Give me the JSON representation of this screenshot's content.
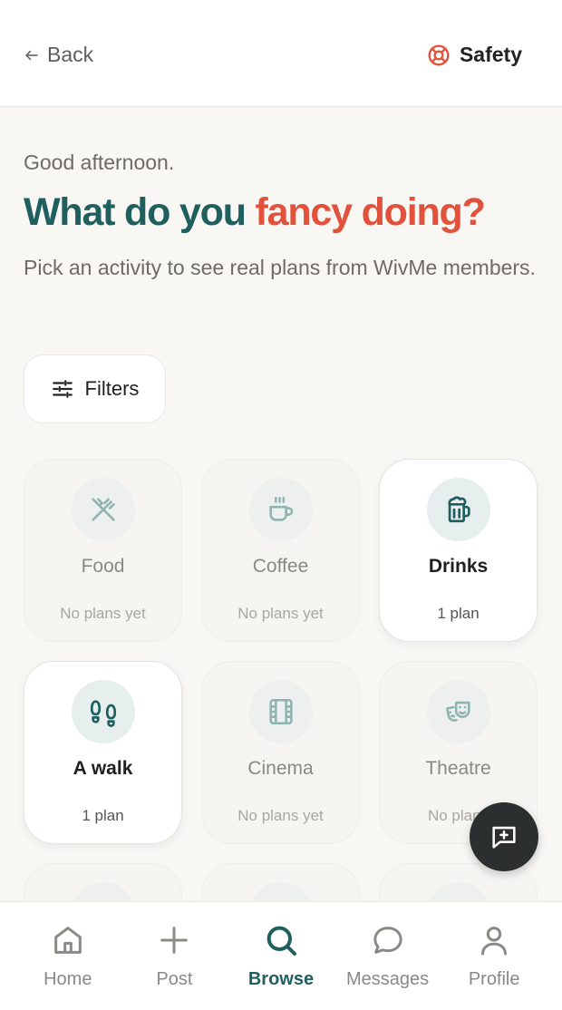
{
  "header": {
    "back_label": "Back",
    "safety_label": "Safety"
  },
  "hero": {
    "greeting": "Good afternoon.",
    "headline_part1": "What do you",
    "headline_part2": "fancy doing?",
    "subtitle": "Pick an activity to see real plans from WivMe members."
  },
  "filters": {
    "label": "Filters"
  },
  "activities": [
    {
      "name": "Food",
      "count": "No plans yet",
      "icon": "fork-knife-icon",
      "active": false
    },
    {
      "name": "Coffee",
      "count": "No plans yet",
      "icon": "coffee-cup-icon",
      "active": false
    },
    {
      "name": "Drinks",
      "count": "1 plan",
      "icon": "beer-mug-icon",
      "active": true
    },
    {
      "name": "A walk",
      "count": "1 plan",
      "icon": "footprints-icon",
      "active": true
    },
    {
      "name": "Cinema",
      "count": "No plans yet",
      "icon": "film-icon",
      "active": false
    },
    {
      "name": "Theatre",
      "count": "No plans",
      "icon": "theatre-masks-icon",
      "active": false
    }
  ],
  "fab": {
    "icon": "message-plus-icon"
  },
  "tabs": [
    {
      "label": "Home",
      "icon": "home-icon",
      "active": false
    },
    {
      "label": "Post",
      "icon": "plus-icon",
      "active": false
    },
    {
      "label": "Browse",
      "icon": "search-icon",
      "active": true
    },
    {
      "label": "Messages",
      "icon": "chat-bubble-icon",
      "active": false
    },
    {
      "label": "Profile",
      "icon": "user-icon",
      "active": false
    }
  ],
  "colors": {
    "teal": "#1f5f5e",
    "coral": "#e2513b",
    "background": "#f8f7f4",
    "fab": "#2c2f2f"
  }
}
